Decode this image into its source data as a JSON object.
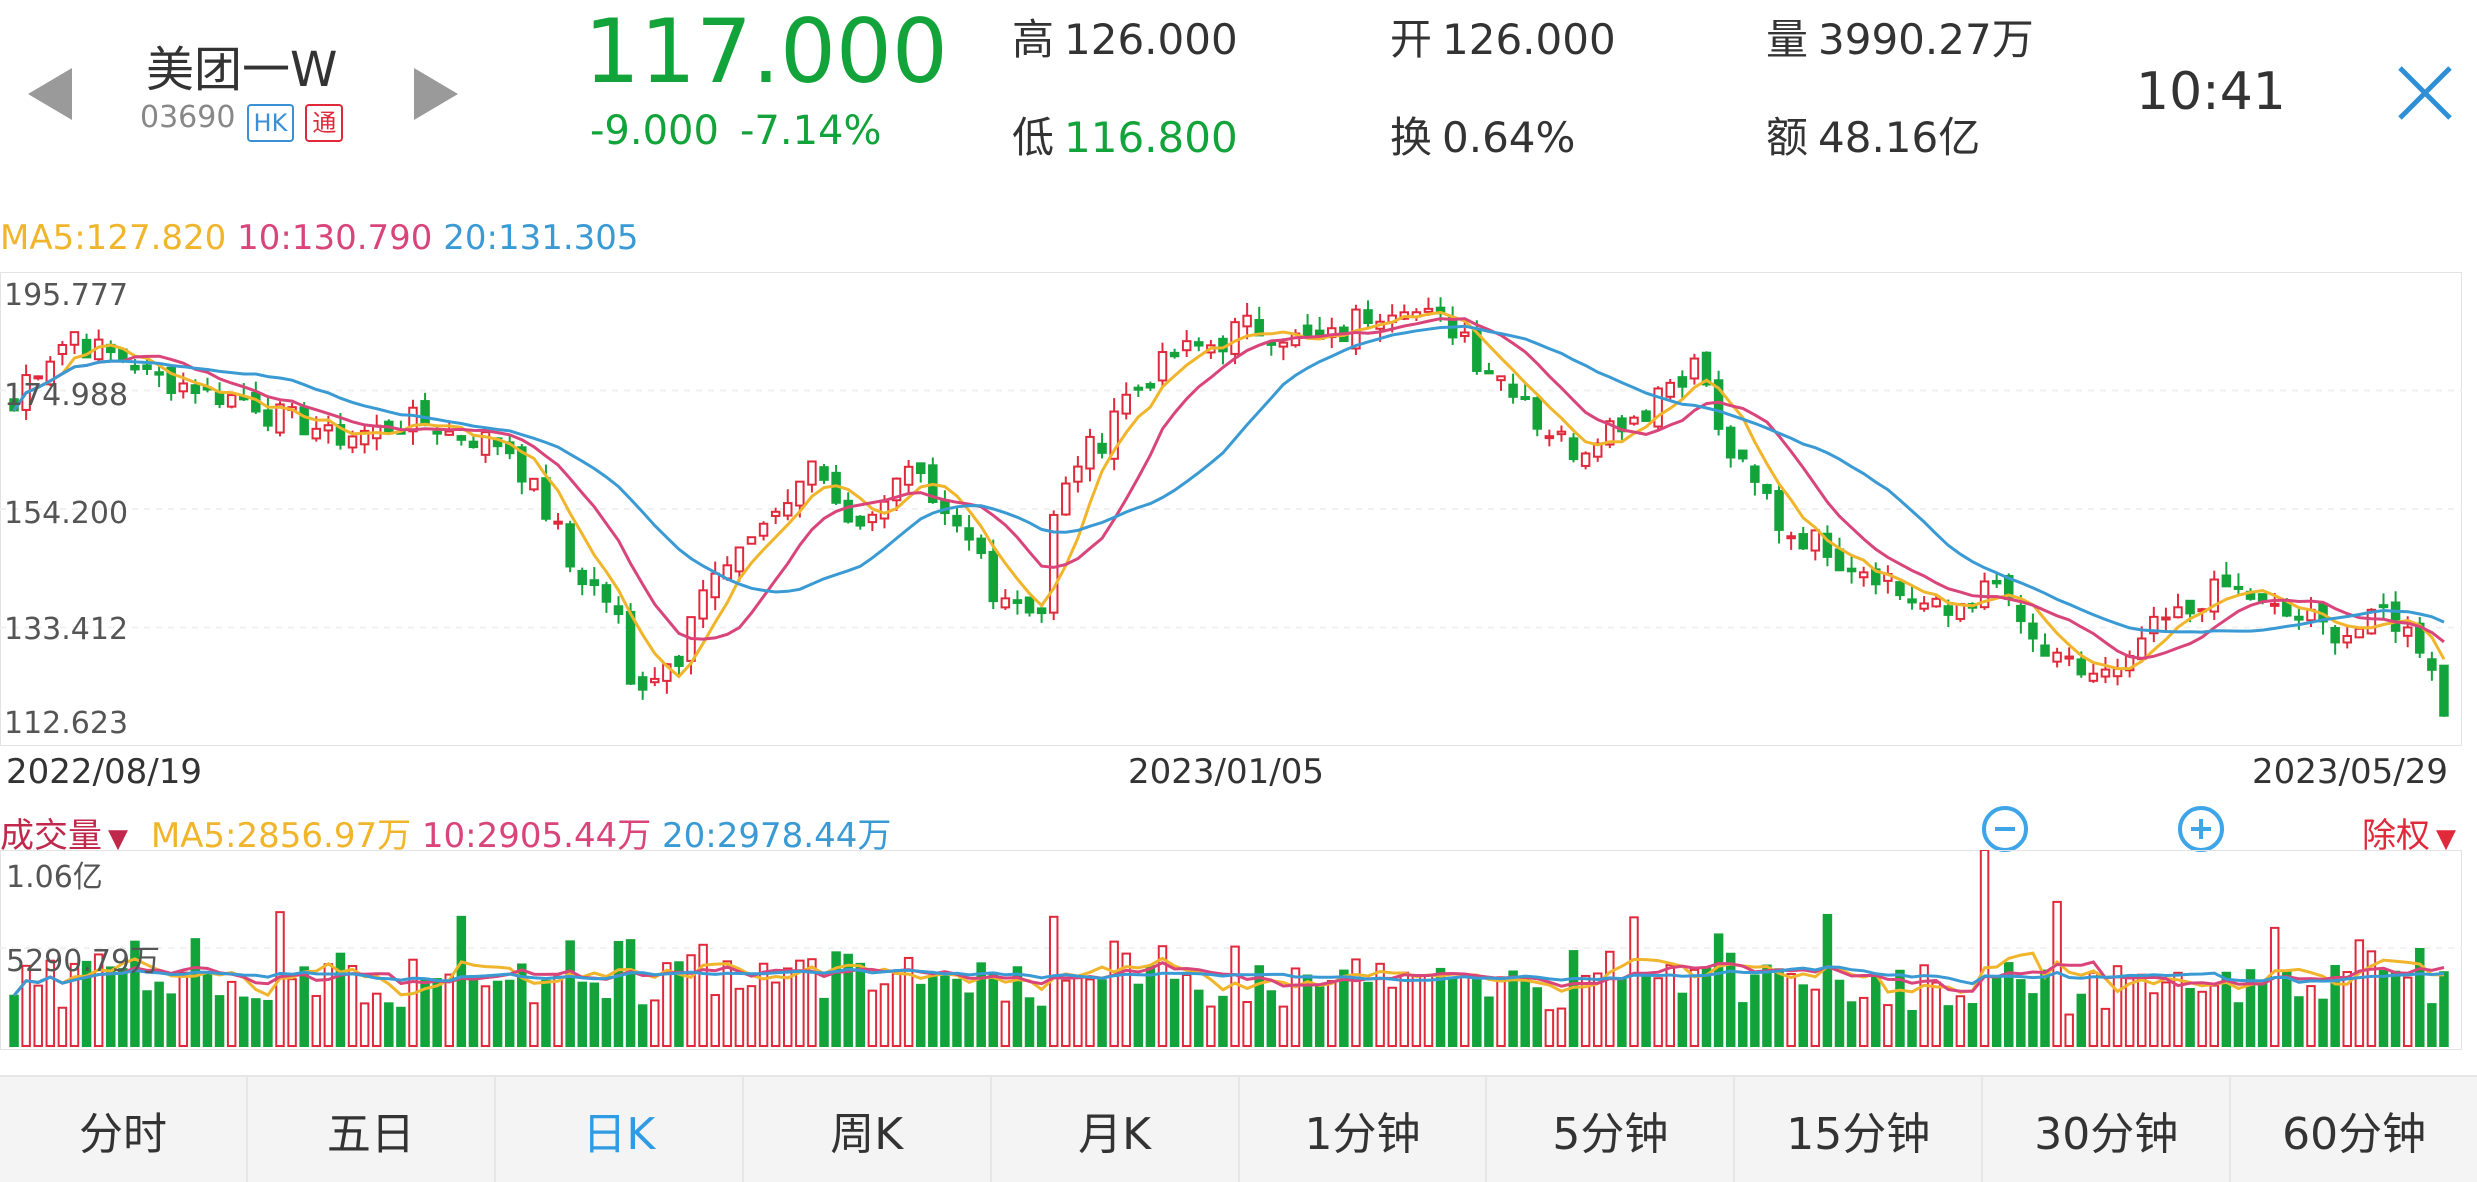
{
  "header": {
    "name": "美团一W",
    "code": "03690",
    "badge_hk": "HK",
    "badge_tong": "通",
    "price": "117.000",
    "change": "-9.000",
    "change_pct": "-7.14%",
    "high_label": "高",
    "high_value": "126.000",
    "low_label": "低",
    "low_value": "116.800",
    "open_label": "开",
    "open_value": "126.000",
    "turnover_label": "换",
    "turnover_value": "0.64%",
    "volume_label": "量",
    "volume_value": "3990.27万",
    "amount_label": "额",
    "amount_value": "48.16亿",
    "time": "10:41"
  },
  "price_chart": {
    "ma5": "MA5:127.820",
    "ma10": "10:130.790",
    "ma20": "20:131.305",
    "y_labels": [
      "195.777",
      "174.988",
      "154.200",
      "133.412",
      "112.623"
    ],
    "x_labels": [
      "2022/08/19",
      "2023/01/05",
      "2023/05/29"
    ]
  },
  "volume_chart": {
    "title": "成交量",
    "ma5": "MA5:2856.97万",
    "ma10": "10:2905.44万",
    "ma20": "20:2978.44万",
    "y_labels": [
      "1.06亿",
      "5290.79万"
    ],
    "adjust_label": "除权"
  },
  "tabs": [
    "分时",
    "五日",
    "日K",
    "周K",
    "月K",
    "1分钟",
    "5分钟",
    "15分钟",
    "30分钟",
    "60分钟"
  ],
  "active_tab": "日K",
  "colors": {
    "up": "#e0293b",
    "down": "#12a33a",
    "ma5": "#f0b52a",
    "ma10": "#d9457a",
    "ma20": "#3a9ad4",
    "accent": "#2f9be3"
  },
  "chart_data": [
    {
      "type": "candlestick",
      "x_start": "2022/08/19",
      "x_end": "2023/05/29",
      "ylim": [
        112.623,
        195.777
      ],
      "close_anchors": [
        [
          "2022/08/19",
          172
        ],
        [
          "2022/08/26",
          186
        ],
        [
          "2022/09/05",
          178
        ],
        [
          "2022/09/15",
          174
        ],
        [
          "2022/09/26",
          167
        ],
        [
          "2022/10/05",
          170
        ],
        [
          "2022/10/17",
          165
        ],
        [
          "2022/10/21",
          150
        ],
        [
          "2022/10/27",
          138
        ],
        [
          "2022/10/31",
          122
        ],
        [
          "2022/11/04",
          128
        ],
        [
          "2022/11/08",
          140
        ],
        [
          "2022/11/14",
          150
        ],
        [
          "2022/11/21",
          163
        ],
        [
          "2022/11/25",
          150
        ],
        [
          "2022/12/01",
          160
        ],
        [
          "2022/12/07",
          150
        ],
        [
          "2022/12/12",
          140
        ],
        [
          "2022/12/16",
          136
        ],
        [
          "2022/12/21",
          163
        ],
        [
          "2022/12/30",
          180
        ],
        [
          "2023/01/10",
          187
        ],
        [
          "2023/01/18",
          184
        ],
        [
          "2023/01/27",
          192
        ],
        [
          "2023/02/03",
          186
        ],
        [
          "2023/02/10",
          175
        ],
        [
          "2023/02/16",
          165
        ],
        [
          "2023/02/24",
          172
        ],
        [
          "2023/03/02",
          180
        ],
        [
          "2023/03/09",
          158
        ],
        [
          "2023/03/14",
          150
        ],
        [
          "2023/03/23",
          143
        ],
        [
          "2023/03/31",
          135
        ],
        [
          "2023/04/06",
          140
        ],
        [
          "2023/04/13",
          126
        ],
        [
          "2023/04/20",
          124
        ],
        [
          "2023/04/26",
          134
        ],
        [
          "2023/05/03",
          140
        ],
        [
          "2023/05/10",
          135
        ],
        [
          "2023/05/17",
          132
        ],
        [
          "2023/05/22",
          136
        ],
        [
          "2023/05/25",
          130
        ],
        [
          "2023/05/29",
          117
        ]
      ],
      "ma_values": {
        "ma5": 127.82,
        "ma10": 130.79,
        "ma20": 131.305
      }
    },
    {
      "type": "bar",
      "title": "成交量",
      "unit": "万",
      "ylim": [
        0,
        10600
      ],
      "reference_levels": [
        10600,
        5290.79
      ],
      "ma_values": {
        "ma5": 2856.97,
        "ma10": 2905.44,
        "ma20": 2978.44
      },
      "last_value": 3990.27
    }
  ]
}
